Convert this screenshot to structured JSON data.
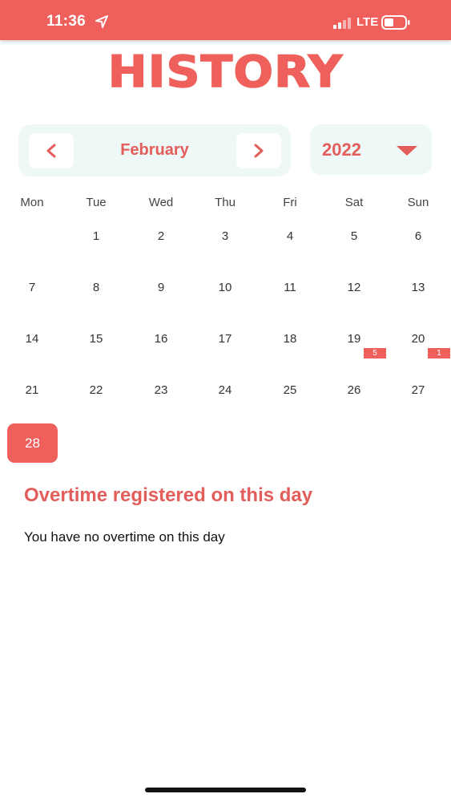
{
  "status_bar": {
    "time": "11:36",
    "network": "LTE"
  },
  "header": {
    "title": "HISTORY"
  },
  "calendar": {
    "month": "February",
    "year": "2022",
    "weekdays": [
      "Mon",
      "Tue",
      "Wed",
      "Thu",
      "Fri",
      "Sat",
      "Sun"
    ],
    "days": {
      "d1": "1",
      "d2": "2",
      "d3": "3",
      "d4": "4",
      "d5": "5",
      "d6": "6",
      "d7": "7",
      "d8": "8",
      "d9": "9",
      "d10": "10",
      "d11": "11",
      "d12": "12",
      "d13": "13",
      "d14": "14",
      "d15": "15",
      "d16": "16",
      "d17": "17",
      "d18": "18",
      "d19": "19",
      "d20": "20",
      "d21": "21",
      "d22": "22",
      "d23": "23",
      "d24": "24",
      "d25": "25",
      "d26": "26",
      "d27": "27",
      "d28": "28"
    },
    "badges": {
      "d19": "5",
      "d20": "1"
    },
    "selected_day": "28"
  },
  "overtime": {
    "heading": "Overtime registered on this day",
    "empty_message": "You have no overtime on this day"
  },
  "colors": {
    "accent": "#ef605c",
    "panel": "#eef8f6"
  }
}
